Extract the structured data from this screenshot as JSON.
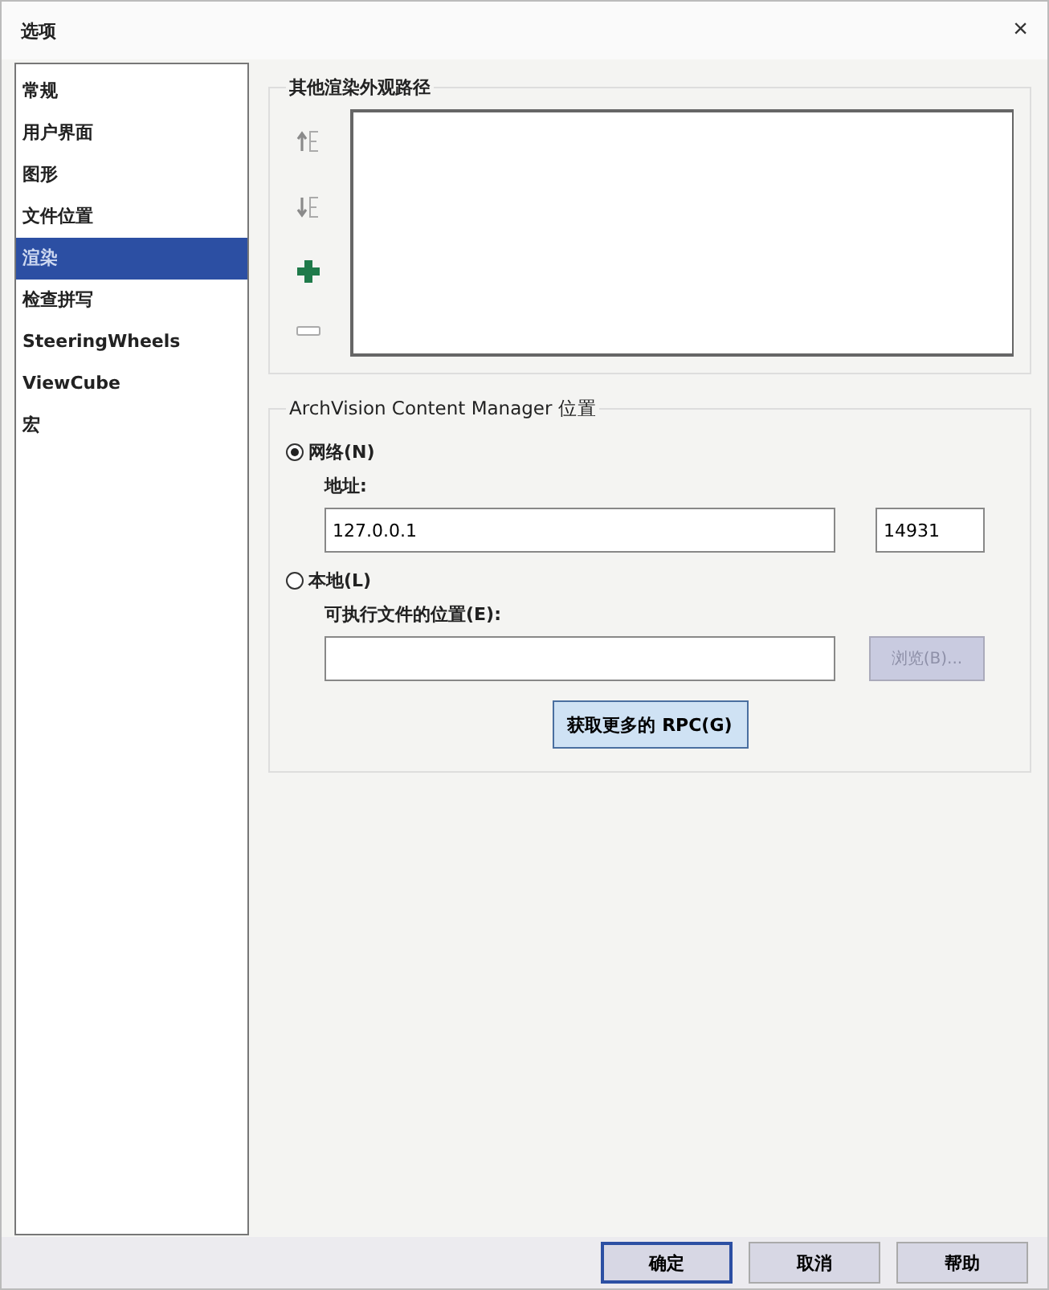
{
  "window": {
    "title": "选项",
    "close": "×"
  },
  "sidebar": {
    "items": [
      {
        "label": "常规",
        "selected": false
      },
      {
        "label": "用户界面",
        "selected": false
      },
      {
        "label": "图形",
        "selected": false
      },
      {
        "label": "文件位置",
        "selected": false
      },
      {
        "label": "渲染",
        "selected": true
      },
      {
        "label": "检查拼写",
        "selected": false
      },
      {
        "label": "SteeringWheels",
        "selected": false
      },
      {
        "label": "ViewCube",
        "selected": false
      },
      {
        "label": "宏",
        "selected": false
      }
    ]
  },
  "render_paths": {
    "title": "其他渲染外观路径",
    "tools": [
      {
        "kind": "move-up",
        "disabled": true
      },
      {
        "kind": "move-down",
        "disabled": true
      },
      {
        "kind": "add",
        "disabled": false
      },
      {
        "kind": "remove",
        "disabled": true
      }
    ]
  },
  "content_manager": {
    "title": "ArchVision Content Manager 位置",
    "options": [
      {
        "label": "网络(N)",
        "selected": true
      },
      {
        "label": "本地(L)",
        "selected": false
      }
    ],
    "address_label": "地址:",
    "address": "127.0.0.1",
    "port": "14931",
    "exe_label": "可执行文件的位置(E):",
    "browse": {
      "label": "浏览(B)...",
      "disabled": true
    },
    "get_rpc": "获取更多的 RPC(G)"
  },
  "buttons": [
    {
      "label": "确定",
      "default": true
    },
    {
      "label": "取消",
      "default": false
    },
    {
      "label": "帮助",
      "default": false
    }
  ]
}
